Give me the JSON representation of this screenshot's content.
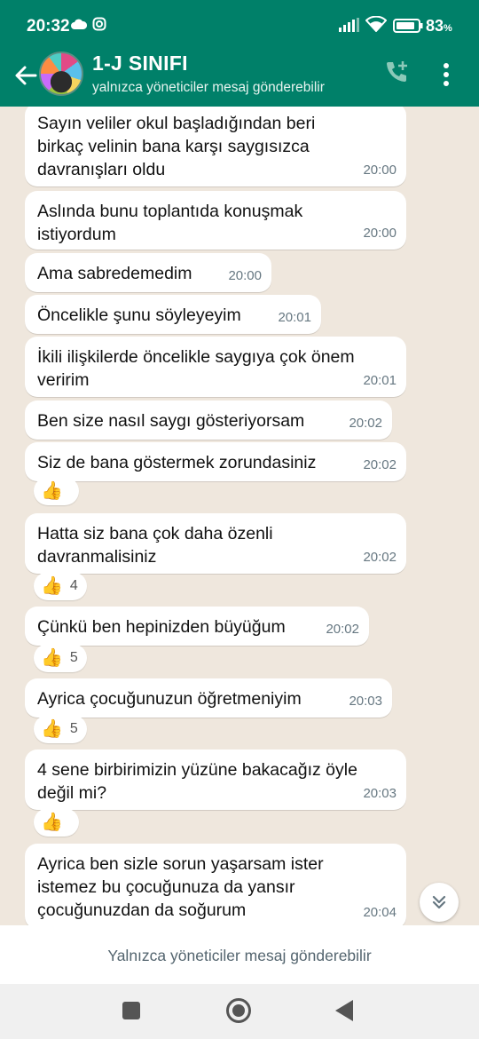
{
  "status_bar": {
    "time": "20:32",
    "battery_value": "83",
    "battery_unit": "%"
  },
  "header": {
    "title": "1-J SINIFI",
    "subtitle": "yalnızca yöneticiler mesaj gönderebilir",
    "icons": [
      "back-arrow-icon",
      "group-avatar",
      "add-call-icon",
      "more-options-icon"
    ]
  },
  "messages": [
    {
      "text": "Sayın veliler okul başladığından beri\nbirkaç velinin bana karşı saygısızca\ndavranışları oldu",
      "time": "20:00"
    },
    {
      "text": "Aslında bunu toplantıda konuşmak\nistiyordum",
      "time": "20:00"
    },
    {
      "text": "Ama sabredemedim",
      "time": "20:00"
    },
    {
      "text": "Öncelikle şunu söyleyeyim",
      "time": "20:01"
    },
    {
      "text": "İkili ilişkilerde öncelikle saygıya çok önem\nveririm",
      "time": "20:01"
    },
    {
      "text": "Ben size nasıl saygı gösteriyorsam",
      "time": "20:02"
    },
    {
      "text": "Siz de bana göstermek zorundasiniz",
      "time": "20:02",
      "reaction": {
        "emoji": "👍",
        "count": ""
      }
    },
    {
      "text": "Hatta siz bana çok daha özenli\ndavranmalisiniz",
      "time": "20:02",
      "reaction": {
        "emoji": "👍",
        "count": "4"
      }
    },
    {
      "text": "Çünkü ben hepinizden büyüğum",
      "time": "20:02",
      "reaction": {
        "emoji": "👍",
        "count": "5"
      }
    },
    {
      "text": "Ayrica çocuğunuzun öğretmeniyim",
      "time": "20:03",
      "reaction": {
        "emoji": "👍",
        "count": "5"
      }
    },
    {
      "text": "4 sene birbirimizin yüzüne bakacağız öyle\ndeğil mi?",
      "time": "20:03",
      "reaction": {
        "emoji": "👍",
        "count": ""
      }
    },
    {
      "text": "Ayrica ben sizle sorun yaşarsam ister\nistemez bu çocuğunuza da yansır\nçocuğunuzdan da soğurum",
      "time": "20:04"
    }
  ],
  "footer": {
    "notice": "Yalnızca yöneticiler mesaj gönderebilir"
  },
  "colors": {
    "header_bg": "#008069",
    "chat_bg": "#efe7dd",
    "bubble_bg": "#ffffff",
    "time_text": "#667781"
  }
}
